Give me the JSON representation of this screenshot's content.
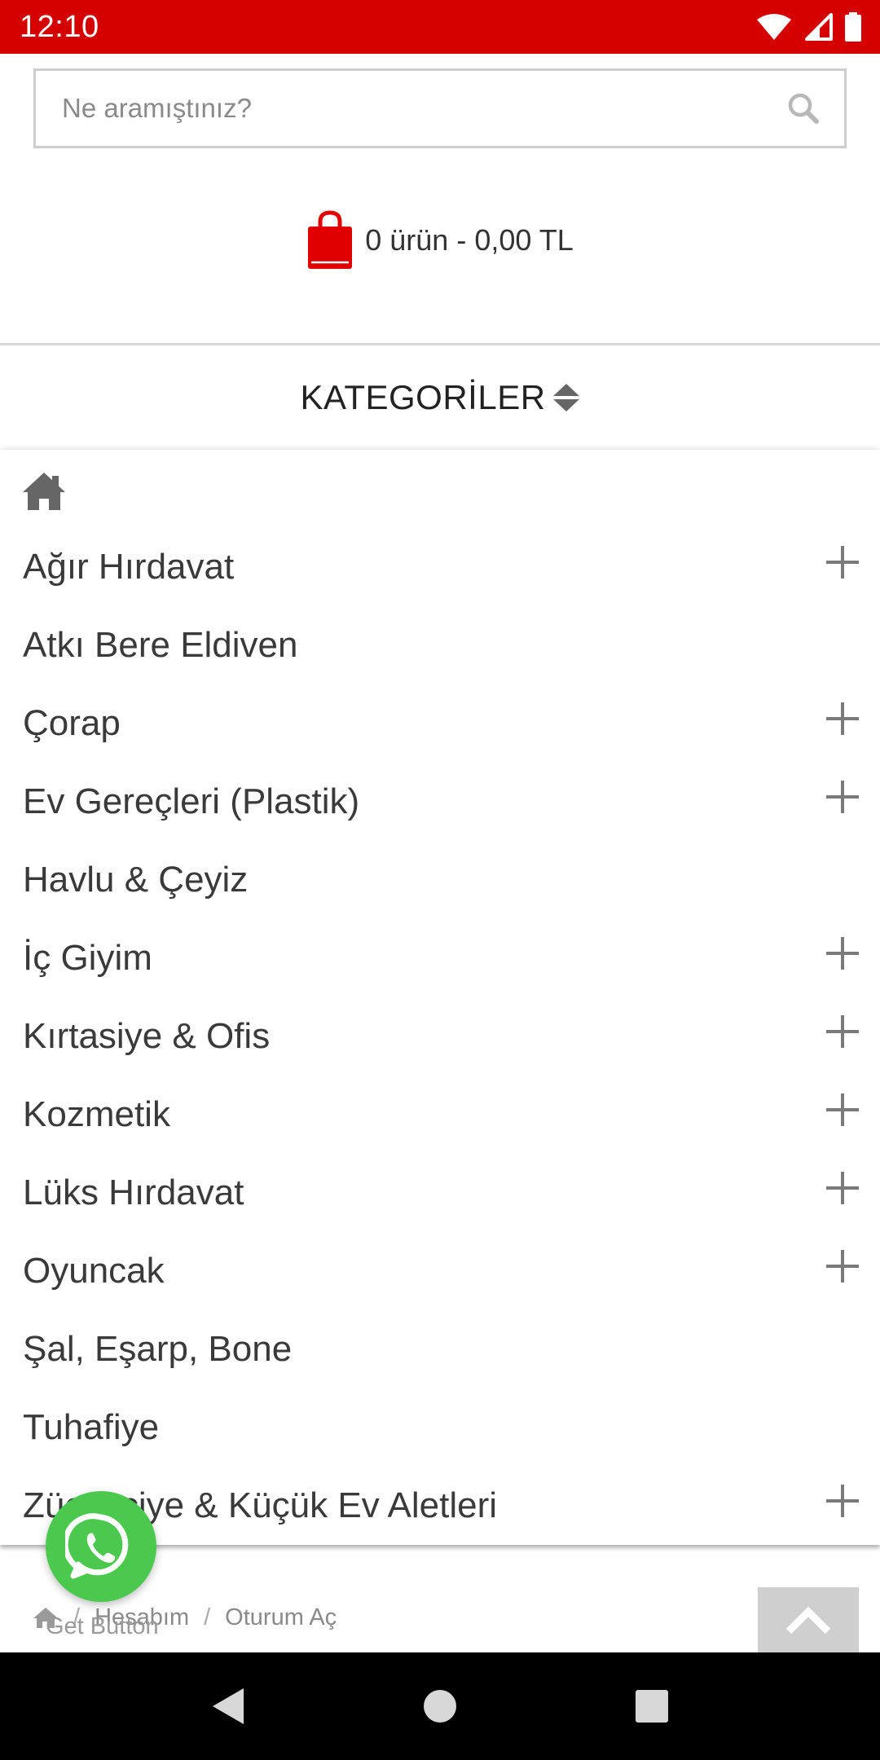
{
  "status_bar": {
    "time": "12:10",
    "icons": [
      "wifi-icon",
      "signal-icon",
      "battery-icon"
    ],
    "background": "#d50000"
  },
  "search": {
    "placeholder": "Ne aramıştınız?",
    "value": ""
  },
  "cart": {
    "summary": "0 ürün - 0,00 TL",
    "icon": "shopping-bag-icon",
    "icon_color": "#e00000"
  },
  "categories": {
    "title": "KATEGORİLER",
    "items": [
      {
        "label": "Ağır Hırdavat",
        "expandable": true
      },
      {
        "label": "Atkı Bere Eldiven",
        "expandable": false
      },
      {
        "label": "Çorap",
        "expandable": true
      },
      {
        "label": "Ev Gereçleri (Plastik)",
        "expandable": true
      },
      {
        "label": "Havlu & Çeyiz",
        "expandable": false
      },
      {
        "label": "İç Giyim",
        "expandable": true
      },
      {
        "label": "Kırtasiye & Ofis",
        "expandable": true
      },
      {
        "label": "Kozmetik",
        "expandable": true
      },
      {
        "label": "Lüks Hırdavat",
        "expandable": true
      },
      {
        "label": "Oyuncak",
        "expandable": true
      },
      {
        "label": "Şal, Eşarp, Bone",
        "expandable": false
      },
      {
        "label": "Tuhafiye",
        "expandable": false
      },
      {
        "label": "Züccaciye & Küçük Ev Aletleri",
        "expandable": true
      }
    ]
  },
  "breadcrumb": {
    "items": [
      "Hesabım",
      "Oturum Aç"
    ],
    "separator": "/"
  },
  "whatsapp": {
    "label": "Get Button",
    "color": "#4bc94f"
  }
}
